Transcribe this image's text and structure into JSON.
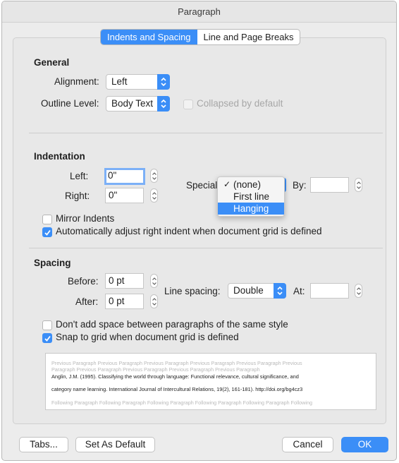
{
  "window": {
    "title": "Paragraph"
  },
  "tabs": [
    {
      "label": "Indents and Spacing",
      "active": true
    },
    {
      "label": "Line and Page Breaks",
      "active": false
    }
  ],
  "general": {
    "heading": "General",
    "alignment_label": "Alignment:",
    "alignment_value": "Left",
    "outline_label": "Outline Level:",
    "outline_value": "Body Text",
    "collapsed_label": "Collapsed by default"
  },
  "indentation": {
    "heading": "Indentation",
    "left_label": "Left:",
    "left_value": "0\"",
    "right_label": "Right:",
    "right_value": "0\"",
    "special_label": "Special",
    "by_label": "By:",
    "by_value": "",
    "special_menu": [
      {
        "label": "(none)",
        "checked": true,
        "highlighted": false
      },
      {
        "label": "First line",
        "checked": false,
        "highlighted": false
      },
      {
        "label": "Hanging",
        "checked": false,
        "highlighted": true
      }
    ],
    "check_mark": "✓",
    "mirror_label": "Mirror Indents",
    "auto_adjust_label": "Automatically adjust right indent when document grid is defined"
  },
  "spacing": {
    "heading": "Spacing",
    "before_label": "Before:",
    "before_value": "0 pt",
    "after_label": "After:",
    "after_value": "0 pt",
    "line_spacing_label": "Line spacing:",
    "line_spacing_value": "Double",
    "at_label": "At:",
    "at_value": "",
    "dont_add_label": "Don't add space between paragraphs of the same style",
    "snap_label": "Snap to grid when document grid is defined"
  },
  "preview": {
    "previous_line1": "Previous Paragraph Previous Paragraph Previous Paragraph Previous Paragraph Previous Paragraph Previous",
    "previous_line2": "Paragraph Previous Paragraph Previous Paragraph Previous Paragraph Previous Paragraph",
    "sample_line1": "Anglin, J.M. (1995). Classifying the world through language: Functional relevance, cultural significance, and",
    "sample_line2": "category name learning. International Journal of Intercultural Relations, 19(2), 161-181). http://doi.org/bg4cz3",
    "following_line": "Following Paragraph Following Paragraph Following Paragraph Following Paragraph Following Paragraph Following"
  },
  "footer": {
    "tabs_label": "Tabs...",
    "default_label": "Set As Default",
    "cancel_label": "Cancel",
    "ok_label": "OK"
  },
  "colors": {
    "accent": "#3b8ef7",
    "background": "#ececec"
  }
}
